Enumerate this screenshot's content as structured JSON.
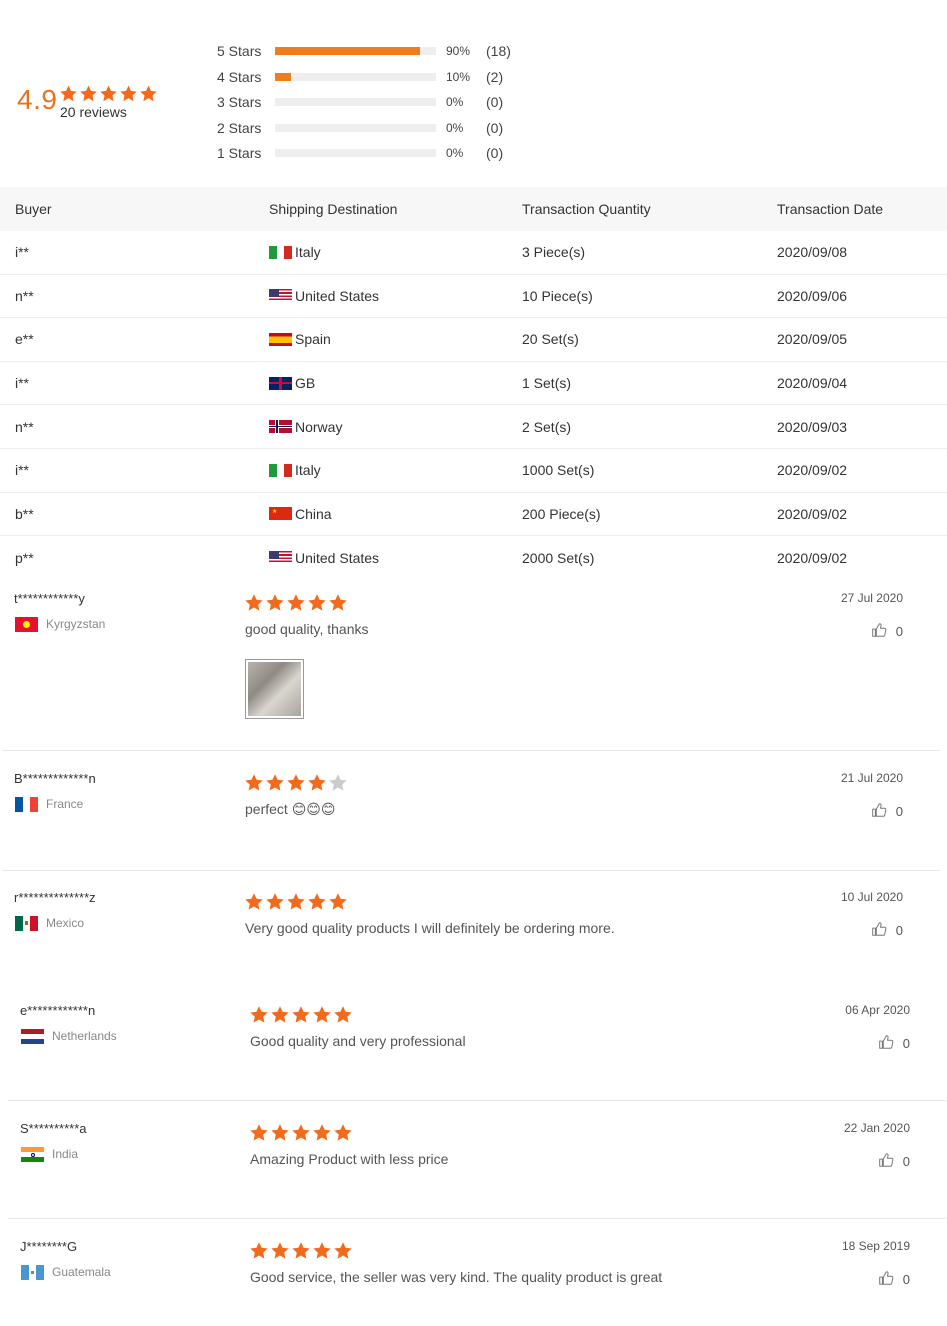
{
  "summary": {
    "score": "4.9",
    "stars_filled": 5,
    "reviews_label": "20 reviews",
    "distribution": [
      {
        "label": "5  Stars",
        "pct": "90%",
        "count": "(18)",
        "fill": 0.9
      },
      {
        "label": "4  Stars",
        "pct": "10%",
        "count": "(2)",
        "fill": 0.1
      },
      {
        "label": "3  Stars",
        "pct": "0%",
        "count": "(0)",
        "fill": 0
      },
      {
        "label": "2  Stars",
        "pct": "0%",
        "count": "(0)",
        "fill": 0
      },
      {
        "label": "1  Stars",
        "pct": "0%",
        "count": "(0)",
        "fill": 0
      }
    ]
  },
  "transactions": {
    "headers": {
      "buyer": "Buyer",
      "destination": "Shipping Destination",
      "quantity": "Transaction Quantity",
      "date": "Transaction Date"
    },
    "rows": [
      {
        "buyer": "i**",
        "flag": "italy-flag",
        "destination": "Italy",
        "quantity": "3 Piece(s)",
        "date": "2020/09/08"
      },
      {
        "buyer": "n**",
        "flag": "us-flag",
        "destination": "United States",
        "quantity": "10 Piece(s)",
        "date": "2020/09/06"
      },
      {
        "buyer": "e**",
        "flag": "spain-flag",
        "destination": "Spain",
        "quantity": "20 Set(s)",
        "date": "2020/09/05"
      },
      {
        "buyer": "i**",
        "flag": "gb-flag",
        "destination": "GB",
        "quantity": "1 Set(s)",
        "date": "2020/09/04"
      },
      {
        "buyer": "n**",
        "flag": "norway-flag",
        "destination": "Norway",
        "quantity": "2 Set(s)",
        "date": "2020/09/03"
      },
      {
        "buyer": "i**",
        "flag": "italy-flag",
        "destination": "Italy",
        "quantity": "1000 Set(s)",
        "date": "2020/09/02"
      },
      {
        "buyer": "b**",
        "flag": "china-flag",
        "destination": "China",
        "quantity": "200 Piece(s)",
        "date": "2020/09/02"
      },
      {
        "buyer": "p**",
        "flag": "us-flag",
        "destination": "United States",
        "quantity": "2000 Set(s)",
        "date": "2020/09/02"
      }
    ]
  },
  "reviews": [
    {
      "name": "t************y",
      "flag": "kyrgyzstan-flag",
      "country": "Kyrgyzstan",
      "stars": 5,
      "text": "good quality, thanks",
      "date": "27 Jul 2020",
      "likes": "0",
      "has_photo": true
    },
    {
      "name": "B*************n",
      "flag": "france-flag",
      "country": "France",
      "stars": 4,
      "text": "perfect 😊😊😊",
      "date": "21 Jul 2020",
      "likes": "0",
      "has_photo": false
    },
    {
      "name": "r**************z",
      "flag": "mexico-flag",
      "country": "Mexico",
      "stars": 5,
      "text": "Very good quality products I will definitely be ordering more.",
      "date": "10 Jul 2020",
      "likes": "0",
      "has_photo": false
    },
    {
      "name": "e************n",
      "flag": "netherlands-flag",
      "country": "Netherlands",
      "stars": 5,
      "text": "Good quality and very professional",
      "date": "06 Apr 2020",
      "likes": "0",
      "has_photo": false
    },
    {
      "name": "S**********a",
      "flag": "india-flag",
      "country": "India",
      "stars": 5,
      "text": "Amazing Product with less price",
      "date": "22 Jan 2020",
      "likes": "0",
      "has_photo": false
    },
    {
      "name": "J********G",
      "flag": "guatemala-flag",
      "country": "Guatemala",
      "stars": 5,
      "text": "Good service, the seller was very kind. The quality product is great",
      "date": "18 Sep 2019",
      "likes": "0",
      "has_photo": false
    }
  ],
  "colors": {
    "accent": "#f07c1c",
    "star": "#f26b1d",
    "star_empty": "#cccccc"
  }
}
